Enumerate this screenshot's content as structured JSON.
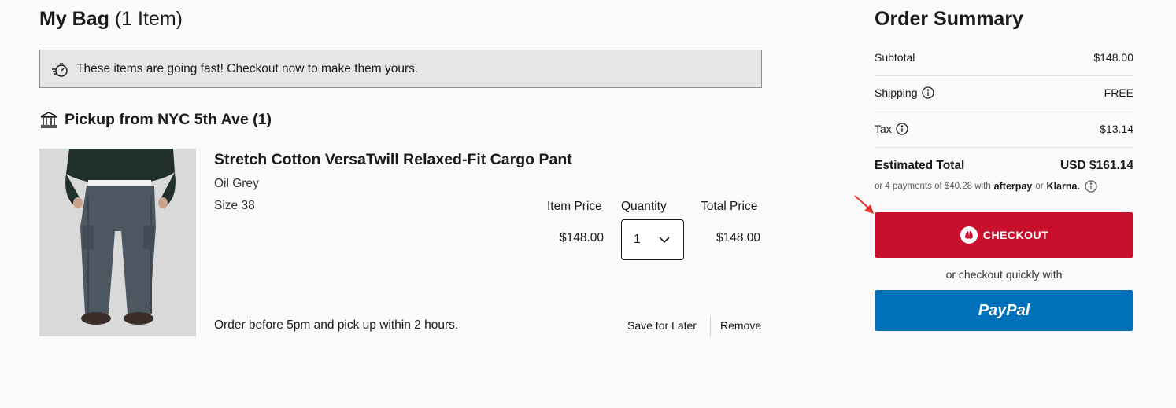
{
  "bag": {
    "title": "My Bag",
    "count": "(1 Item)",
    "urgency_text": "These items are going fast! Checkout now to make them yours.",
    "pickup_heading": "Pickup from NYC 5th Ave (1)"
  },
  "item": {
    "name": "Stretch Cotton VersaTwill Relaxed-Fit Cargo Pant",
    "color": "Oil Grey",
    "size": "Size 38",
    "item_price_label": "Item Price",
    "quantity_label": "Quantity",
    "total_price_label": "Total Price",
    "item_price": "$148.00",
    "quantity": "1",
    "total_price": "$148.00",
    "pickup_note": "Order before 5pm and pick up within 2 hours.",
    "save_for_later": "Save for Later",
    "remove": "Remove"
  },
  "summary": {
    "title": "Order Summary",
    "subtotal_label": "Subtotal",
    "subtotal_value": "$148.00",
    "shipping_label": "Shipping",
    "shipping_value": "FREE",
    "tax_label": "Tax",
    "tax_value": "$13.14",
    "estimated_label": "Estimated Total",
    "estimated_value": "USD $161.14",
    "installments_prefix": "or 4 payments of $40.28 with",
    "afterpay_brand": "afterpay",
    "installments_or": "or",
    "klarna_brand": "Klarna.",
    "checkout_label": "CHECKOUT",
    "quick_checkout_text": "or checkout quickly with",
    "paypal_label": "PayPal"
  },
  "colors": {
    "checkout_red": "#c8102e",
    "paypal_blue": "#0070ba",
    "urgency_bg": "#e6e6e6",
    "annotation_arrow": "#e8332b"
  },
  "icons": {
    "urgency": "stopwatch-icon",
    "pickup": "store-icon",
    "quantity": "chevron-down-icon",
    "info": "info-icon",
    "checkout": "lululemon-logo-icon"
  }
}
